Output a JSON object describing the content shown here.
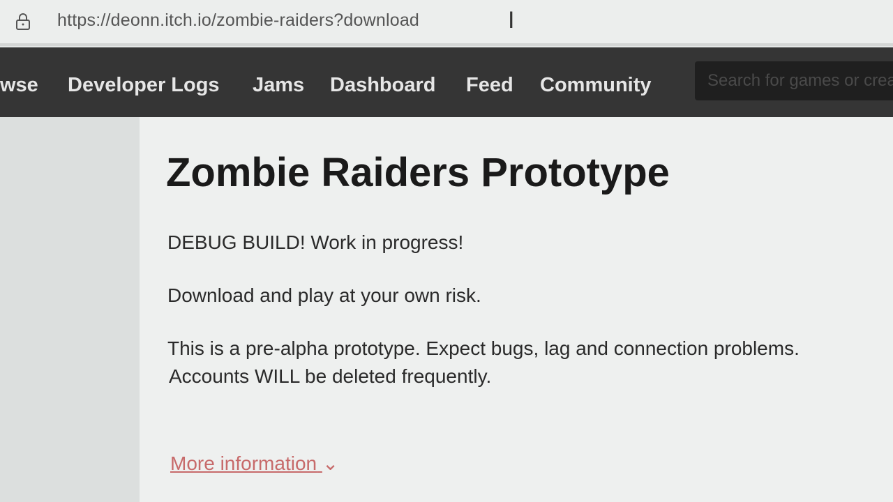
{
  "browser": {
    "url": "https://deonn.itch.io/zombie-raiders?download"
  },
  "nav": {
    "items": [
      "wse",
      "Developer Logs",
      "Jams",
      "Dashboard",
      "Feed",
      "Community"
    ],
    "search_placeholder": "Search for games or creators"
  },
  "page": {
    "title": "Zombie Raiders Prototype",
    "paragraphs": [
      "DEBUG BUILD! Work in progress!",
      "Download and play at your own risk.",
      "This is a pre-alpha prototype. Expect bugs, lag and connection problems.",
      "Accounts WILL be deleted frequently."
    ],
    "more_info": "More information"
  },
  "colors": {
    "nav_bg": "#353535",
    "link": "#c76a6a"
  }
}
